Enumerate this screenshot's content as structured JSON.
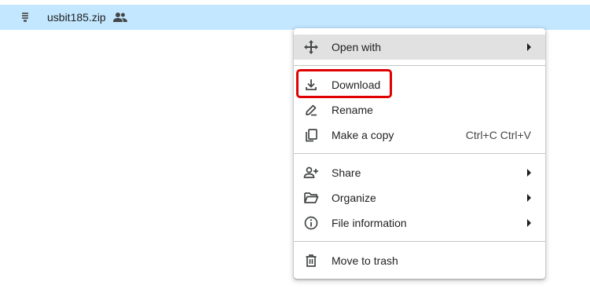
{
  "file": {
    "name": "usbit185.zip",
    "type_icon": "zip-file-icon",
    "shared_icon": "people-icon"
  },
  "menu": {
    "items": [
      {
        "label": "Open with",
        "icon": "move-arrows-icon",
        "has_submenu": true
      },
      {
        "label": "Download",
        "icon": "download-icon"
      },
      {
        "label": "Rename",
        "icon": "pencil-icon"
      },
      {
        "label": "Make a copy",
        "icon": "copy-icon",
        "shortcut": "Ctrl+C Ctrl+V"
      },
      {
        "label": "Share",
        "icon": "person-add-icon",
        "has_submenu": true
      },
      {
        "label": "Organize",
        "icon": "folder-open-icon",
        "has_submenu": true
      },
      {
        "label": "File information",
        "icon": "info-icon",
        "has_submenu": true
      },
      {
        "label": "Move to trash",
        "icon": "trash-icon"
      }
    ]
  },
  "colors": {
    "selected_row": "#c2e7ff",
    "menu_hover": "#e1e1e1",
    "highlight_border": "#e00000"
  }
}
